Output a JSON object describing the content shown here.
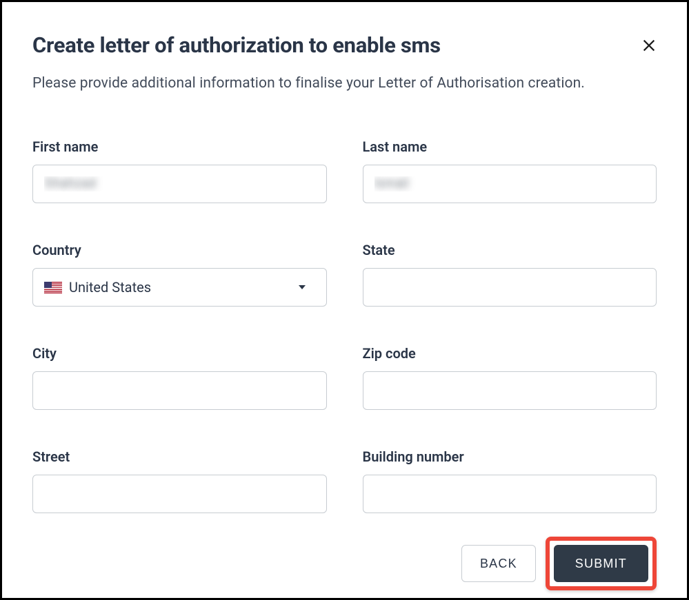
{
  "dialog": {
    "title": "Create letter of authorization to enable sms",
    "description": "Please provide additional information to finalise your Letter of Authorisation creation."
  },
  "fields": {
    "first_name": {
      "label": "First name",
      "value": "Shahzad"
    },
    "last_name": {
      "label": "Last name",
      "value": "Ismail"
    },
    "country": {
      "label": "Country",
      "selected": "United States"
    },
    "state": {
      "label": "State",
      "value": ""
    },
    "city": {
      "label": "City",
      "value": ""
    },
    "zip_code": {
      "label": "Zip code",
      "value": ""
    },
    "street": {
      "label": "Street",
      "value": ""
    },
    "building_number": {
      "label": "Building number",
      "value": ""
    }
  },
  "buttons": {
    "back": "BACK",
    "submit": "SUBMIT"
  }
}
